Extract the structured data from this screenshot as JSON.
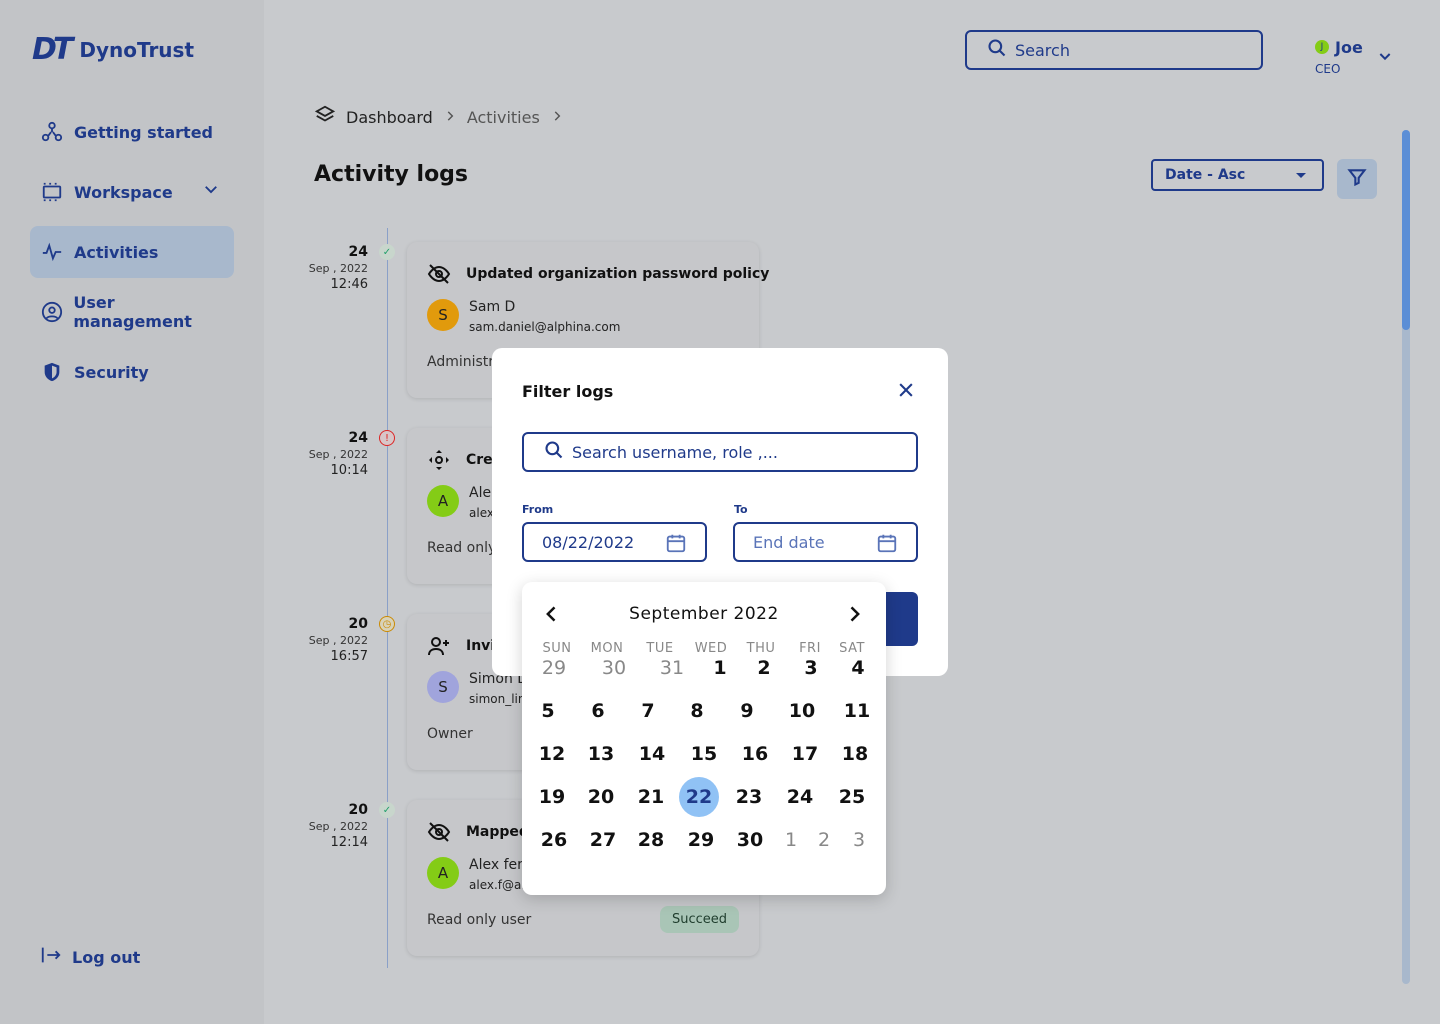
{
  "app": {
    "name": "DynoTrust",
    "logo_mark": "DT"
  },
  "sidebar": {
    "items": [
      {
        "label": "Getting started",
        "icon": "nodes-icon"
      },
      {
        "label": "Workspace",
        "icon": "workspace-icon"
      },
      {
        "label": "Activities",
        "icon": "activity-icon"
      },
      {
        "label": "User management",
        "icon": "user-circle-icon"
      },
      {
        "label": "Security",
        "icon": "shield-icon"
      }
    ],
    "active": "Activities",
    "logout_label": "Log out"
  },
  "header": {
    "search_placeholder": "Search",
    "user": {
      "initial": "J",
      "name": "Joe",
      "role": "CEO"
    }
  },
  "breadcrumb": [
    "Dashboard",
    "Activities"
  ],
  "page": {
    "title": "Activity logs",
    "sort_label": "Date - Asc"
  },
  "timeline": [
    {
      "day": "24",
      "month": "Sep , 2022",
      "time": "12:46",
      "status": "success",
      "title": "Updated organization password policy",
      "icon": "eye-off-icon",
      "avatar": "S",
      "avatar_color": "#e19a0c",
      "name": "Sam D",
      "email": "sam.daniel@alphina.com",
      "role": "Administr"
    },
    {
      "day": "24",
      "month": "Sep , 2022",
      "time": "10:14",
      "status": "error",
      "title": "Crea",
      "icon": "move-icon",
      "avatar": "A",
      "avatar_color": "#84cc16",
      "name": "Ale",
      "email": "alex",
      "role": "Read only"
    },
    {
      "day": "20",
      "month": "Sep , 2022",
      "time": "16:57",
      "status": "pending",
      "title": "Invi",
      "icon": "user-plus-icon",
      "avatar": "S",
      "avatar_color": "#a0a4dc",
      "name": "Simon L",
      "email": "simon_lin",
      "role": "Owner"
    },
    {
      "day": "20",
      "month": "Sep , 2022",
      "time": "12:14",
      "status": "success",
      "title": "Mapped",
      "icon": "eye-off-icon",
      "avatar": "A",
      "avatar_color": "#84cc16",
      "name": "Alex fer",
      "email": "alex.f@al",
      "role": "Read only user",
      "badge": "Succeed"
    }
  ],
  "filter_modal": {
    "title": "Filter  logs",
    "search_placeholder": "Search username, role ,...",
    "from_label": "From",
    "from_value": "08/22/2022",
    "to_label": "To",
    "to_placeholder": "End date"
  },
  "calendar": {
    "month_label": "September 2022",
    "weekdays": [
      "SUN",
      "MON",
      "TUE",
      "WED",
      "THU",
      "FRI",
      "SAT"
    ],
    "weeks": [
      [
        "29",
        "30",
        "31",
        "1",
        "2",
        "3",
        "4"
      ],
      [
        "5",
        "6",
        "7",
        "8",
        "9",
        "10",
        "11"
      ],
      [
        "12",
        "13",
        "14",
        "15",
        "16",
        "17",
        "18"
      ],
      [
        "19",
        "20",
        "21",
        "22",
        "23",
        "24",
        "25"
      ],
      [
        "26",
        "27",
        "28",
        "29",
        "30",
        "1",
        "2",
        "3"
      ]
    ],
    "selected": "22"
  },
  "colors": {
    "brand": "#1f3a8a",
    "active_nav": "#a8b8cc",
    "selected_day": "#90c2f5",
    "success_badge": "#a9c5b6"
  }
}
